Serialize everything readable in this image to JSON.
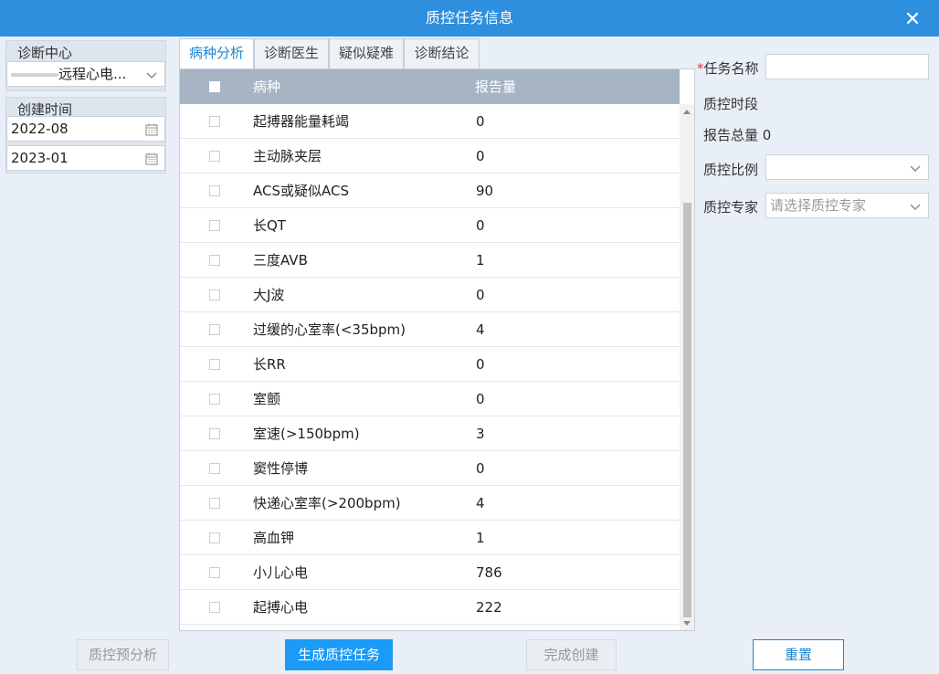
{
  "window": {
    "title": "质控任务信息"
  },
  "filters": {
    "center_label": "诊断中心",
    "center_value": "远程心电...",
    "created_label": "创建时间",
    "date_start": "2022-08",
    "date_end": "2023-01"
  },
  "tabs": [
    {
      "label": "病种分析",
      "active": true
    },
    {
      "label": "诊断医生",
      "active": false
    },
    {
      "label": "疑似疑难",
      "active": false
    },
    {
      "label": "诊断结论",
      "active": false
    }
  ],
  "table": {
    "headers": {
      "name": "病种",
      "count": "报告量"
    },
    "rows": [
      {
        "name": "起搏器能量耗竭",
        "count": "0"
      },
      {
        "name": "主动脉夹层",
        "count": "0"
      },
      {
        "name": "ACS或疑似ACS",
        "count": "90"
      },
      {
        "name": "长QT",
        "count": "0"
      },
      {
        "name": "三度AVB",
        "count": "1"
      },
      {
        "name": "大J波",
        "count": "0"
      },
      {
        "name": "过缓的心室率(<35bpm)",
        "count": "4"
      },
      {
        "name": "长RR",
        "count": "0"
      },
      {
        "name": "室颤",
        "count": "0"
      },
      {
        "name": "室速(>150bpm)",
        "count": "3"
      },
      {
        "name": "窦性停博",
        "count": "0"
      },
      {
        "name": "快递心室率(>200bpm)",
        "count": "4"
      },
      {
        "name": "高血钾",
        "count": "1"
      },
      {
        "name": "小儿心电",
        "count": "786"
      },
      {
        "name": "起搏心电",
        "count": "222"
      }
    ]
  },
  "form": {
    "required_mark": "*",
    "task_name_label": "任务名称",
    "task_name_value": "",
    "period_label": "质控时段",
    "total_label": "报告总量",
    "total_value": "0",
    "ratio_label": "质控比例",
    "ratio_value": "",
    "expert_label": "质控专家",
    "expert_placeholder": "请选择质控专家"
  },
  "buttons": {
    "pre_analysis": "质控预分析",
    "generate": "生成质控任务",
    "complete": "完成创建",
    "reset": "重置"
  },
  "colors": {
    "titlebar": "#2d8fdd",
    "primary_button": "#1b9af7",
    "table_header": "#a6b4c4",
    "active_tab_text": "#1b86d6",
    "required": "#e53935"
  }
}
